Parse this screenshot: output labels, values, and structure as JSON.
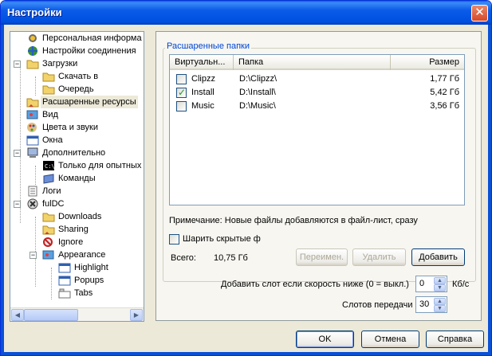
{
  "window": {
    "title": "Настройки",
    "close_glyph": "✕"
  },
  "tree": {
    "items": [
      {
        "label": "Персональная информа",
        "icon": "person-icon"
      },
      {
        "label": "Настройки соединения",
        "icon": "globe-icon"
      },
      {
        "label": "Загрузки",
        "icon": "folder-icon",
        "expander": "−"
      },
      {
        "label": "Скачать в",
        "icon": "folder-icon"
      },
      {
        "label": "Очередь",
        "icon": "folder-icon"
      },
      {
        "label": "Расшаренные ресурсы",
        "icon": "shared-folder-icon",
        "selected": true
      },
      {
        "label": "Вид",
        "icon": "palette-icon"
      },
      {
        "label": "Цвета и звуки",
        "icon": "paint-icon"
      },
      {
        "label": "Окна",
        "icon": "window-icon"
      },
      {
        "label": "Дополнительно",
        "icon": "computer-icon",
        "expander": "−"
      },
      {
        "label": "Только для опытных",
        "icon": "console-icon"
      },
      {
        "label": "Команды",
        "icon": "command-icon"
      },
      {
        "label": "Логи",
        "icon": "log-icon"
      },
      {
        "label": "fulDC",
        "icon": "fuldc-icon",
        "expander": "−"
      },
      {
        "label": "Downloads",
        "icon": "folder-icon"
      },
      {
        "label": "Sharing",
        "icon": "shared-folder-icon"
      },
      {
        "label": "Ignore",
        "icon": "ignore-icon"
      },
      {
        "label": "Appearance",
        "icon": "palette-icon",
        "expander": "−"
      },
      {
        "label": "Highlight",
        "icon": "window-icon"
      },
      {
        "label": "Popups",
        "icon": "window-icon"
      },
      {
        "label": "Tabs",
        "icon": "tabs-icon"
      }
    ]
  },
  "shares": {
    "group_title": "Расшаренные папки",
    "columns": [
      "Виртуальн...",
      "Папка",
      "Размер"
    ],
    "rows": [
      {
        "virtual": "Clipzz",
        "folder": "D:\\Clipzz\\",
        "size": "1,77 Гб",
        "checked": false
      },
      {
        "virtual": "Install",
        "folder": "D:\\Install\\",
        "size": "5,42 Гб",
        "checked": true
      },
      {
        "virtual": "Music",
        "folder": "D:\\Music\\",
        "size": "3,56 Гб",
        "checked": false
      }
    ],
    "note": "Примечание: Новые файлы добавляются в файл-лист, сразу",
    "share_hidden_label": "Шарить скрытые ф",
    "total_label": "Всего:",
    "total_value": "10,75 Гб",
    "rename_btn": "Переимен.",
    "remove_btn": "Удалить",
    "add_btn": "Добавить"
  },
  "slots": {
    "extra_slot_label": "Добавить слот если скорость ниже (0 = выкл.)",
    "extra_slot_value": "0",
    "extra_slot_unit": "Кб/с",
    "upload_slots_label": "Слотов передачи",
    "upload_slots_value": "30"
  },
  "footer": {
    "ok": "OK",
    "cancel": "Отмена",
    "help": "Справка"
  },
  "colors": {
    "titlebar": "#0a5be8",
    "accent_group": "#0046d5",
    "check": "#21a121"
  }
}
